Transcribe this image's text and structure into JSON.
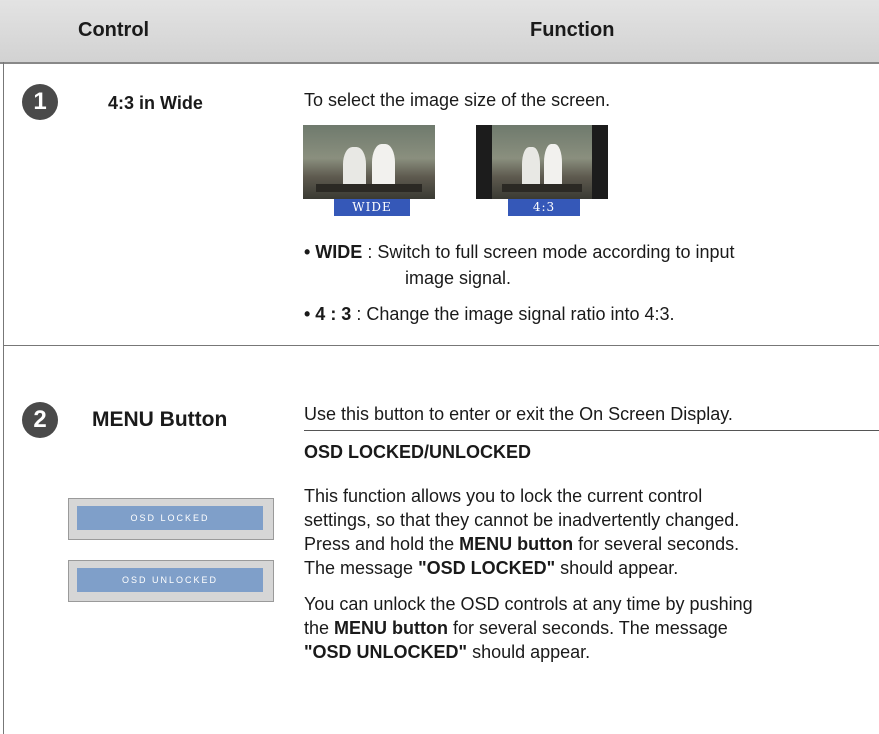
{
  "header": {
    "control": "Control",
    "function": "Function"
  },
  "row1": {
    "number": "1",
    "control_label": "4:3 in Wide",
    "intro": "To select the image size of the screen.",
    "thumb_wide_label": "WIDE",
    "thumb_43_label": "4:3",
    "bullet1_term": "• WIDE",
    "bullet1_text": " : Switch to full screen mode according to input",
    "bullet1_cont": "image signal.",
    "bullet2_term": "• 4 : 3",
    "bullet2_text": " : Change the image signal ratio into 4:3."
  },
  "row2": {
    "number": "2",
    "control_label": "MENU Button",
    "osd_locked": "OSD LOCKED",
    "osd_unlocked": "OSD UNLOCKED",
    "intro": "Use this button to enter or exit the On Screen Display.",
    "subheading": "OSD LOCKED/UNLOCKED",
    "p1_line1": "This function allows you to lock the current control",
    "p1_line2": "settings, so that they cannot be inadvertently changed.",
    "p1_line3_a": "Press and hold the ",
    "p1_line3_b": "MENU button",
    "p1_line3_c": " for several seconds.",
    "p1_line4_a": "The message ",
    "p1_line4_b": "\"OSD LOCKED\"",
    "p1_line4_c": " should appear.",
    "p2_line1": "You can unlock the OSD controls at any time by pushing",
    "p2_line2_a": "the ",
    "p2_line2_b": "MENU button",
    "p2_line2_c": " for several seconds. The message",
    "p2_line3_a": "\"OSD UNLOCKED\"",
    "p2_line3_b": " should appear."
  }
}
